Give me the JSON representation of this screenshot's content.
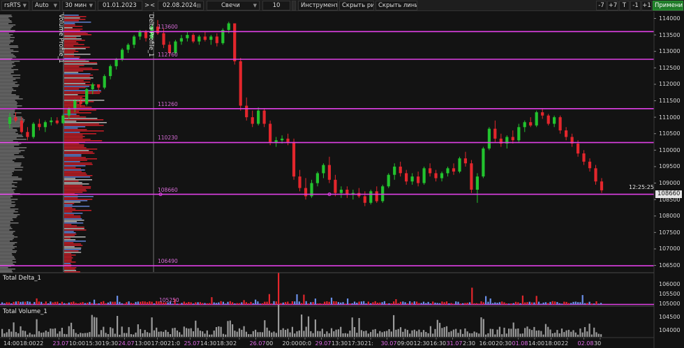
{
  "toolbar": {
    "symbol": "rsRTS",
    "mode": "Auto",
    "timeframe": "30 мин",
    "date_from": "01.01.2023",
    "nav_next": ">",
    "nav_prev": "<",
    "date_to": "02.08.2024",
    "chart_type": "Свечи",
    "count": "10",
    "tools": "Инструменты",
    "hide_drawings": "Скрыть рис.",
    "hide_lines": "Скрыть линии",
    "btn_minus7": "-7",
    "btn_plus7": "+7",
    "btn_t": "T",
    "btn_minus1": "-1",
    "btn_plus1": "+1",
    "apply": "Применить"
  },
  "indicators": {
    "volume_profile": "Volume Profile_1",
    "delta_profile": "Delta Profile_1",
    "total_delta": "Total Delta_1",
    "total_volume": "Total Volume_1"
  },
  "price_axis": [
    "114000",
    "113500",
    "113000",
    "112500",
    "112000",
    "111500",
    "111000",
    "110500",
    "110000",
    "109500",
    "109000",
    "108500",
    "108000",
    "107500",
    "107000",
    "106500"
  ],
  "delta_axis": [
    "106000",
    "105500",
    "105000"
  ],
  "volume_axis": [
    "104500",
    "104000"
  ],
  "current_time": "12:25:25",
  "current_price": "108660",
  "levels": [
    {
      "label": "113600",
      "price": 113600
    },
    {
      "label": "112760",
      "price": 112760
    },
    {
      "label": "111260",
      "price": 111260
    },
    {
      "label": "110230",
      "price": 110230
    },
    {
      "label": "108660",
      "price": 108660
    },
    {
      "label": "106490",
      "price": 106490
    }
  ],
  "delta_level": {
    "label": "105250"
  },
  "time_axis": [
    {
      "t": "14:00",
      "hl": false
    },
    {
      "t": "18:00",
      "hl": false
    },
    {
      "t": "22",
      "hl": false
    },
    {
      "t": "23.07",
      "hl": true
    },
    {
      "t": "10:00",
      "hl": false
    },
    {
      "t": "15:30",
      "hl": false
    },
    {
      "t": "19:30",
      "hl": false
    },
    {
      "t": "24.07",
      "hl": true
    },
    {
      "t": "13:00",
      "hl": false
    },
    {
      "t": "17:00",
      "hl": false
    },
    {
      "t": "21:0",
      "hl": false
    },
    {
      "t": "25.07",
      "hl": true
    },
    {
      "t": "14:30",
      "hl": false
    },
    {
      "t": "18:30",
      "hl": false
    },
    {
      "t": "2",
      "hl": false
    },
    {
      "t": "26.07",
      "hl": true
    },
    {
      "t": "00",
      "hl": false
    },
    {
      "t": "20:00",
      "hl": false
    },
    {
      "t": "00:0",
      "hl": false
    },
    {
      "t": "29.07",
      "hl": true
    },
    {
      "t": "13:30",
      "hl": false
    },
    {
      "t": "17:30",
      "hl": false
    },
    {
      "t": "21:",
      "hl": false
    },
    {
      "t": "30.07",
      "hl": true
    },
    {
      "t": "09:00",
      "hl": false
    },
    {
      "t": "12:30",
      "hl": false
    },
    {
      "t": "16:30",
      "hl": false
    },
    {
      "t": "31.07",
      "hl": true
    },
    {
      "t": "2:30",
      "hl": false
    },
    {
      "t": "16:00",
      "hl": false
    },
    {
      "t": "20:30",
      "hl": false
    },
    {
      "t": "01.08",
      "hl": true
    },
    {
      "t": "14:00",
      "hl": false
    },
    {
      "t": "18:00",
      "hl": false
    },
    {
      "t": "22",
      "hl": false
    },
    {
      "t": "02.08",
      "hl": true
    },
    {
      "t": "30",
      "hl": false
    }
  ],
  "chart_data": {
    "type": "candlestick",
    "y_range": [
      106300,
      114200
    ],
    "candles": [
      [
        110800,
        111120,
        110650,
        111000
      ],
      [
        111000,
        111150,
        110850,
        110900
      ],
      [
        110900,
        111000,
        110500,
        110550
      ],
      [
        110550,
        110700,
        110300,
        110400
      ],
      [
        110400,
        110850,
        110350,
        110800
      ],
      [
        110800,
        110950,
        110600,
        110700
      ],
      [
        110700,
        110900,
        110550,
        110850
      ],
      [
        110850,
        111000,
        110750,
        110900
      ],
      [
        110900,
        111000,
        110780,
        110820
      ],
      [
        110820,
        111100,
        110800,
        111050
      ],
      [
        111050,
        111300,
        110950,
        111250
      ],
      [
        111250,
        111550,
        111150,
        111500
      ],
      [
        111500,
        111600,
        111300,
        111400
      ],
      [
        111400,
        111900,
        111350,
        111850
      ],
      [
        111850,
        112050,
        111700,
        112000
      ],
      [
        112000,
        111950,
        111800,
        111900
      ],
      [
        111900,
        112300,
        111850,
        112250
      ],
      [
        112250,
        112600,
        112150,
        112550
      ],
      [
        112550,
        112800,
        112450,
        112750
      ],
      [
        112750,
        113100,
        112700,
        113050
      ],
      [
        113050,
        113250,
        112950,
        113200
      ],
      [
        113200,
        113500,
        113100,
        113450
      ],
      [
        113450,
        113650,
        113350,
        113600
      ],
      [
        113600,
        113650,
        113300,
        113400
      ],
      [
        113400,
        113800,
        113350,
        113750
      ],
      [
        113750,
        113950,
        113500,
        113550
      ],
      [
        113550,
        113700,
        113100,
        113200
      ],
      [
        113200,
        113300,
        112850,
        112950
      ],
      [
        112950,
        113350,
        112900,
        113300
      ],
      [
        113300,
        113500,
        113200,
        113400
      ],
      [
        113400,
        113600,
        113300,
        113500
      ],
      [
        113500,
        113550,
        113250,
        113300
      ],
      [
        113300,
        113500,
        113200,
        113450
      ],
      [
        113450,
        113600,
        113300,
        113350
      ],
      [
        113350,
        113500,
        113200,
        113450
      ],
      [
        113450,
        113550,
        113150,
        113250
      ],
      [
        113250,
        113700,
        113200,
        113650
      ],
      [
        113650,
        113900,
        113550,
        113850
      ],
      [
        113850,
        113750,
        112600,
        112700
      ],
      [
        112700,
        112800,
        111200,
        111350
      ],
      [
        111350,
        111600,
        110900,
        111000
      ],
      [
        111000,
        111200,
        110700,
        110800
      ],
      [
        110800,
        111300,
        110750,
        111200
      ],
      [
        111200,
        111250,
        110700,
        110800
      ],
      [
        110800,
        110900,
        110150,
        110250
      ],
      [
        110250,
        110400,
        110100,
        110300
      ],
      [
        110300,
        110450,
        110200,
        110350
      ],
      [
        110350,
        110500,
        110150,
        110250
      ],
      [
        110250,
        110350,
        109100,
        109200
      ],
      [
        109200,
        109400,
        108750,
        108850
      ],
      [
        108850,
        109150,
        108500,
        108600
      ],
      [
        108600,
        109100,
        108550,
        109000
      ],
      [
        109000,
        109350,
        108900,
        109300
      ],
      [
        109300,
        109600,
        109150,
        109550
      ],
      [
        109550,
        109800,
        109000,
        109100
      ],
      [
        109100,
        109250,
        108600,
        108700
      ],
      [
        108700,
        108900,
        108550,
        108800
      ],
      [
        108800,
        108900,
        108550,
        108650
      ],
      [
        108650,
        108800,
        108500,
        108700
      ],
      [
        108700,
        108850,
        108550,
        108600
      ],
      [
        108600,
        108750,
        108300,
        108400
      ],
      [
        108400,
        108800,
        108350,
        108750
      ],
      [
        108750,
        108900,
        108400,
        108450
      ],
      [
        108450,
        108950,
        108400,
        108900
      ],
      [
        108900,
        109300,
        108850,
        109250
      ],
      [
        109250,
        109600,
        109100,
        109500
      ],
      [
        109500,
        109650,
        109200,
        109300
      ],
      [
        109300,
        109400,
        108950,
        109050
      ],
      [
        109050,
        109300,
        108950,
        109200
      ],
      [
        109200,
        109350,
        108900,
        109000
      ],
      [
        109000,
        109500,
        108950,
        109450
      ],
      [
        109450,
        109600,
        109200,
        109300
      ],
      [
        109300,
        109400,
        109050,
        109150
      ],
      [
        109150,
        109350,
        109050,
        109300
      ],
      [
        109300,
        109500,
        109200,
        109450
      ],
      [
        109450,
        109600,
        109250,
        109350
      ],
      [
        109350,
        109800,
        109300,
        109750
      ],
      [
        109750,
        109950,
        109500,
        109600
      ],
      [
        109600,
        109700,
        108700,
        108800
      ],
      [
        108800,
        109300,
        108400,
        109200
      ],
      [
        109200,
        110100,
        109150,
        110050
      ],
      [
        110050,
        110700,
        110000,
        110650
      ],
      [
        110650,
        110900,
        110250,
        110350
      ],
      [
        110350,
        110500,
        110100,
        110200
      ],
      [
        110200,
        110450,
        110050,
        110400
      ],
      [
        110400,
        110600,
        110200,
        110300
      ],
      [
        110300,
        110800,
        110250,
        110700
      ],
      [
        110700,
        110900,
        110550,
        110850
      ],
      [
        110850,
        111000,
        110700,
        110750
      ],
      [
        110750,
        111200,
        110700,
        111150
      ],
      [
        111150,
        111250,
        110950,
        111050
      ],
      [
        111050,
        111100,
        110750,
        110800
      ],
      [
        110800,
        111050,
        110700,
        111000
      ],
      [
        111000,
        111050,
        110500,
        110600
      ],
      [
        110600,
        110700,
        110300,
        110400
      ],
      [
        110400,
        110500,
        110100,
        110200
      ],
      [
        110200,
        110300,
        109800,
        109900
      ],
      [
        109900,
        110000,
        109550,
        109650
      ],
      [
        109650,
        109750,
        109350,
        109450
      ],
      [
        109450,
        109550,
        108950,
        109050
      ],
      [
        109050,
        109150,
        108700,
        108780
      ]
    ]
  }
}
